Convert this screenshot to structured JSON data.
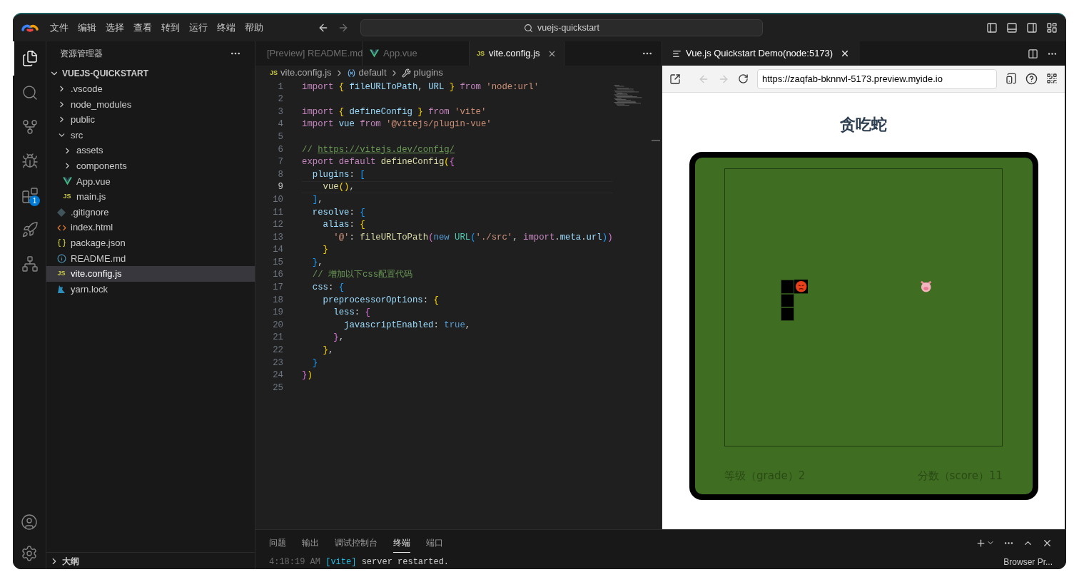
{
  "menu": [
    "文件",
    "编辑",
    "选择",
    "查看",
    "转到",
    "运行",
    "终端",
    "帮助"
  ],
  "command_center": {
    "label": "vuejs-quickstart"
  },
  "activity_bar": [
    {
      "kind": "explorer",
      "selected": true
    },
    {
      "kind": "search",
      "selected": false
    },
    {
      "kind": "source_control",
      "selected": false
    },
    {
      "kind": "debug",
      "selected": false
    },
    {
      "kind": "extensions",
      "selected": false,
      "badge": "1"
    },
    {
      "kind": "deploy",
      "selected": false
    },
    {
      "kind": "share",
      "selected": false
    }
  ],
  "activity_bar_bottom": [
    {
      "kind": "account"
    },
    {
      "kind": "settings"
    }
  ],
  "sidebar": {
    "title": "资源管理器",
    "root": "VUEJS-QUICKSTART",
    "items": [
      {
        "label": ".vscode",
        "kind": "folder",
        "expanded": false,
        "selected": false
      },
      {
        "label": "node_modules",
        "kind": "folder",
        "expanded": false,
        "selected": false
      },
      {
        "label": "public",
        "kind": "folder",
        "expanded": false,
        "selected": false
      },
      {
        "label": "src",
        "kind": "folder",
        "expanded": true,
        "selected": false,
        "children": [
          {
            "label": "assets",
            "kind": "folder",
            "expanded": false,
            "selected": false
          },
          {
            "label": "components",
            "kind": "folder",
            "expanded": false,
            "selected": false
          },
          {
            "label": "App.vue",
            "kind": "vue",
            "selected": false
          },
          {
            "label": "main.js",
            "kind": "js",
            "icon_text": "JS",
            "selected": false
          }
        ]
      },
      {
        "label": ".gitignore",
        "kind": "git",
        "selected": false
      },
      {
        "label": "index.html",
        "kind": "html",
        "selected": false
      },
      {
        "label": "package.json",
        "kind": "json",
        "selected": false
      },
      {
        "label": "README.md",
        "kind": "info",
        "selected": false
      },
      {
        "label": "vite.config.js",
        "kind": "js",
        "icon_text": "JS",
        "selected": true
      },
      {
        "label": "yarn.lock",
        "kind": "yarn",
        "selected": false
      }
    ],
    "outline": {
      "label": "大纲",
      "expanded": false
    }
  },
  "editor_tabs": [
    {
      "label": "[Preview] README.md",
      "kind": "preview",
      "selected": false
    },
    {
      "label": "App.vue",
      "kind": "vue",
      "selected": false
    },
    {
      "label": "vite.config.js",
      "kind": "js",
      "icon_text": "JS",
      "selected": true
    }
  ],
  "breadcrumb": [
    {
      "label": "vite.config.js",
      "kind": "js",
      "icon_text": "JS"
    },
    {
      "label": "default",
      "kind": "variable"
    },
    {
      "label": "plugins",
      "kind": "property"
    }
  ],
  "code_lines": [
    {
      "n": "1",
      "active": false,
      "tokens": [
        {
          "kind": "kw",
          "text": "import "
        },
        {
          "kind": "b1",
          "text": "{ "
        },
        {
          "kind": "var",
          "text": "fileURLToPath"
        },
        {
          "kind": "plain",
          "text": ", "
        },
        {
          "kind": "var",
          "text": "URL"
        },
        {
          "kind": "b1",
          "text": " }"
        },
        {
          "kind": "kw",
          "text": " from "
        },
        {
          "kind": "str",
          "text": "'node:url'"
        }
      ]
    },
    {
      "n": "2",
      "active": false
    },
    {
      "n": "3",
      "active": false,
      "tokens": [
        {
          "kind": "kw",
          "text": "import "
        },
        {
          "kind": "b1",
          "text": "{ "
        },
        {
          "kind": "var",
          "text": "defineConfig"
        },
        {
          "kind": "b1",
          "text": " }"
        },
        {
          "kind": "kw",
          "text": " from "
        },
        {
          "kind": "str",
          "text": "'vite'"
        }
      ]
    },
    {
      "n": "4",
      "active": false,
      "tokens": [
        {
          "kind": "kw",
          "text": "import "
        },
        {
          "kind": "var",
          "text": "vue"
        },
        {
          "kind": "kw",
          "text": " from "
        },
        {
          "kind": "str",
          "text": "'@vitejs/plugin-vue'"
        }
      ]
    },
    {
      "n": "5",
      "active": false
    },
    {
      "n": "6",
      "active": false,
      "tokens": [
        {
          "kind": "com",
          "text": "// "
        },
        {
          "kind": "link",
          "text": "https://vitejs.dev/config/"
        }
      ]
    },
    {
      "n": "7",
      "active": false,
      "tokens": [
        {
          "kind": "kw",
          "text": "export default "
        },
        {
          "kind": "fn",
          "text": "defineConfig"
        },
        {
          "kind": "b1",
          "text": "("
        },
        {
          "kind": "b2",
          "text": "{"
        }
      ]
    },
    {
      "n": "8",
      "active": false,
      "tokens": [
        {
          "kind": "var",
          "text": "  plugins"
        },
        {
          "kind": "plain",
          "text": ": "
        },
        {
          "kind": "b3",
          "text": "["
        }
      ]
    },
    {
      "n": "9",
      "active": true,
      "tokens": [
        {
          "kind": "fn",
          "text": "    vue"
        },
        {
          "kind": "b1",
          "text": "()"
        },
        {
          "kind": "plain",
          "text": ","
        }
      ]
    },
    {
      "n": "10",
      "active": false,
      "tokens": [
        {
          "kind": "b3",
          "text": "  ]"
        },
        {
          "kind": "plain",
          "text": ","
        }
      ]
    },
    {
      "n": "11",
      "active": false,
      "tokens": [
        {
          "kind": "var",
          "text": "  resolve"
        },
        {
          "kind": "plain",
          "text": ": "
        },
        {
          "kind": "b3",
          "text": "{"
        }
      ]
    },
    {
      "n": "12",
      "active": false,
      "tokens": [
        {
          "kind": "var",
          "text": "    alias"
        },
        {
          "kind": "plain",
          "text": ": "
        },
        {
          "kind": "b1",
          "text": "{"
        }
      ]
    },
    {
      "n": "13",
      "active": false,
      "tokens": [
        {
          "kind": "str",
          "text": "      '@'"
        },
        {
          "kind": "plain",
          "text": ": "
        },
        {
          "kind": "fn",
          "text": "fileURLToPath"
        },
        {
          "kind": "b2",
          "text": "("
        },
        {
          "kind": "kw2",
          "text": "new "
        },
        {
          "kind": "cls",
          "text": "URL"
        },
        {
          "kind": "b3",
          "text": "("
        },
        {
          "kind": "str",
          "text": "'./src'"
        },
        {
          "kind": "plain",
          "text": ", "
        },
        {
          "kind": "kw",
          "text": "import"
        },
        {
          "kind": "plain",
          "text": "."
        },
        {
          "kind": "var",
          "text": "meta"
        },
        {
          "kind": "plain",
          "text": "."
        },
        {
          "kind": "var",
          "text": "url"
        },
        {
          "kind": "b3",
          "text": ")"
        },
        {
          "kind": "b2",
          "text": ")"
        }
      ]
    },
    {
      "n": "14",
      "active": false,
      "tokens": [
        {
          "kind": "b1",
          "text": "    }"
        }
      ]
    },
    {
      "n": "15",
      "active": false,
      "tokens": [
        {
          "kind": "b3",
          "text": "  }"
        },
        {
          "kind": "plain",
          "text": ","
        }
      ]
    },
    {
      "n": "16",
      "active": false,
      "tokens": [
        {
          "kind": "com",
          "text": "  // 增加以下css配置代码"
        }
      ]
    },
    {
      "n": "17",
      "active": false,
      "tokens": [
        {
          "kind": "var",
          "text": "  css"
        },
        {
          "kind": "plain",
          "text": ": "
        },
        {
          "kind": "b3",
          "text": "{"
        }
      ]
    },
    {
      "n": "18",
      "active": false,
      "tokens": [
        {
          "kind": "var",
          "text": "    preprocessorOptions"
        },
        {
          "kind": "plain",
          "text": ": "
        },
        {
          "kind": "b1",
          "text": "{"
        }
      ]
    },
    {
      "n": "19",
      "active": false,
      "tokens": [
        {
          "kind": "var",
          "text": "      less"
        },
        {
          "kind": "plain",
          "text": ": "
        },
        {
          "kind": "b2",
          "text": "{"
        }
      ]
    },
    {
      "n": "20",
      "active": false,
      "tokens": [
        {
          "kind": "var",
          "text": "        javascriptEnabled"
        },
        {
          "kind": "plain",
          "text": ": "
        },
        {
          "kind": "kw2",
          "text": "true"
        },
        {
          "kind": "plain",
          "text": ","
        }
      ]
    },
    {
      "n": "21",
      "active": false,
      "tokens": [
        {
          "kind": "b2",
          "text": "      }"
        },
        {
          "kind": "plain",
          "text": ","
        }
      ]
    },
    {
      "n": "22",
      "active": false,
      "tokens": [
        {
          "kind": "b1",
          "text": "    }"
        },
        {
          "kind": "plain",
          "text": ","
        }
      ]
    },
    {
      "n": "23",
      "active": false,
      "tokens": [
        {
          "kind": "b3",
          "text": "  }"
        }
      ]
    },
    {
      "n": "24",
      "active": false,
      "tokens": [
        {
          "kind": "b2",
          "text": "}"
        },
        {
          "kind": "b1",
          "text": ")"
        }
      ]
    },
    {
      "n": "25",
      "active": false
    }
  ],
  "preview": {
    "tab": {
      "label": "Vue.js Quickstart Demo(node:5173)",
      "selected": true
    },
    "browser": {
      "url": "https://zaqfab-bknnvl-5173.preview.myide.io",
      "back_disabled": true,
      "forward_disabled": true
    },
    "page": {
      "title": "贪吃蛇",
      "grade": "等级（grade）2",
      "score": "分数（score）11"
    }
  },
  "panel": {
    "tabs": [
      {
        "label": "问题",
        "selected": false
      },
      {
        "label": "输出",
        "selected": false
      },
      {
        "label": "调试控制台",
        "selected": false
      },
      {
        "label": "终端",
        "selected": true
      },
      {
        "label": "端口",
        "selected": false
      }
    ],
    "terminal": [
      {
        "kind": "time",
        "text": "4:18:19 AM "
      },
      {
        "kind": "tag",
        "text": "[vite]"
      },
      {
        "kind": "plain",
        "text": " server restarted."
      }
    ],
    "status": "Browser Pr..."
  }
}
